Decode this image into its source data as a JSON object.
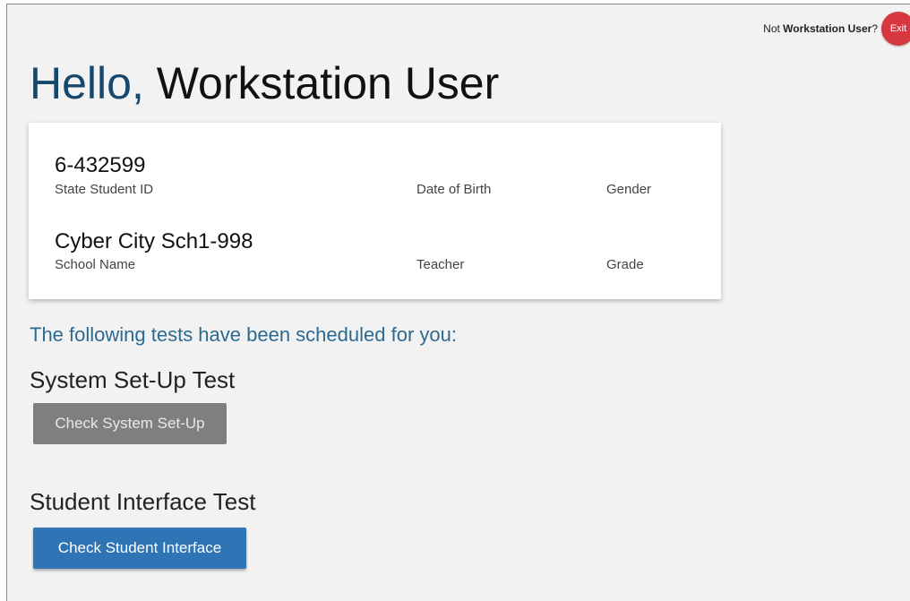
{
  "header": {
    "not_prefix": "Not ",
    "user_name": "Workstation User",
    "question_mark": "?",
    "exit_label": "Exit"
  },
  "greeting": {
    "hello": "Hello,",
    "name": "Workstation User"
  },
  "student_card": {
    "student_id_value": "6-432599",
    "student_id_label": "State Student ID",
    "dob_label": "Date of Birth",
    "gender_label": "Gender",
    "school_value": "Cyber City Sch1-998",
    "school_label": "School Name",
    "teacher_label": "Teacher",
    "grade_label": "Grade"
  },
  "scheduled_text": "The following tests have been scheduled for you:",
  "tests": [
    {
      "heading": "System Set-Up Test",
      "button_label": "Check System Set-Up"
    },
    {
      "heading": "Student Interface Test",
      "button_label": "Check Student Interface"
    }
  ],
  "colors": {
    "hello_accent": "#16486e",
    "scheduled_text": "#2d6a91",
    "exit_button": "#d7373f",
    "primary_button": "#2f74b5",
    "disabled_button": "#7f7f7f",
    "page_background": "#f2f2f2"
  }
}
